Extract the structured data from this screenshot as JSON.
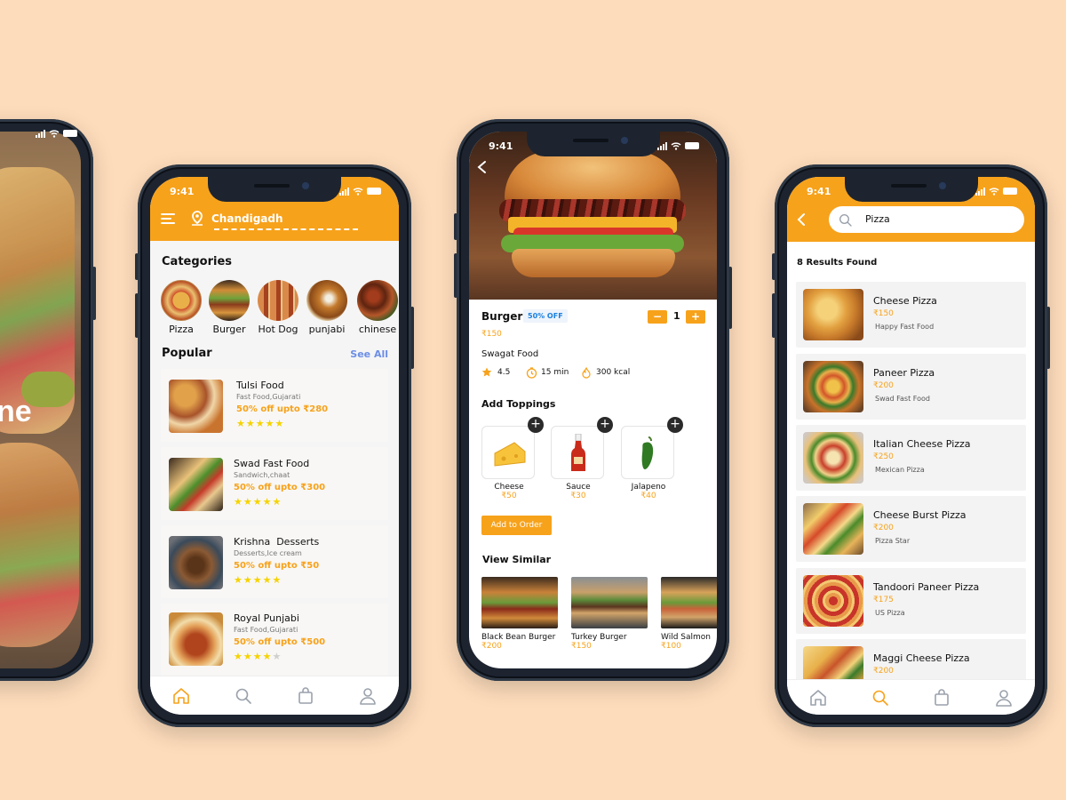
{
  "status_time": "9:41",
  "colors": {
    "accent": "#f7a21b",
    "background": "#fddcbb",
    "star": "#f5d300",
    "badge_text": "#1b7fe0"
  },
  "phone1": {
    "partial_text": "ne"
  },
  "phone2": {
    "location": "Chandigadh",
    "categories_title": "Categories",
    "categories": [
      {
        "label": "Pizza",
        "icon": "pizza-icon"
      },
      {
        "label": "Burger",
        "icon": "burger-icon"
      },
      {
        "label": "Hot Dog",
        "icon": "hotdog-icon"
      },
      {
        "label": "punjabi",
        "icon": "punjabi-dish-icon"
      },
      {
        "label": "chinese",
        "icon": "chinese-dish-icon"
      }
    ],
    "popular_title": "Popular",
    "see_all": "See All",
    "restaurants": [
      {
        "name": "Tulsi Food",
        "cuisine": "Fast Food,Gujarati",
        "offer": "50% off upto ₹280",
        "rating": 5
      },
      {
        "name": "Swad Fast Food",
        "cuisine": "Sandwich,chaat",
        "offer": "50% off upto ₹300",
        "rating": 5
      },
      {
        "name": "Krishna  Desserts",
        "cuisine": "Desserts,Ice cream",
        "offer": "50% off upto ₹50",
        "rating": 5
      },
      {
        "name": "Royal Punjabi",
        "cuisine": "Fast Food,Gujarati",
        "offer": "50% off upto ₹500",
        "rating": 4
      }
    ],
    "active_tab": "home"
  },
  "phone3": {
    "item_name": "Burger",
    "badge": "50% OFF",
    "price": "₹150",
    "quantity": "1",
    "qty_minus": "−",
    "qty_plus": "+",
    "restaurant": "Swagat Food",
    "rating": "4.5",
    "time": "15 min",
    "calories": "300 kcal",
    "toppings_title": "Add Toppings",
    "toppings": [
      {
        "name": "Cheese",
        "price": "₹50",
        "icon": "cheese-icon"
      },
      {
        "name": "Sauce",
        "price": "₹30",
        "icon": "sauce-bottle-icon"
      },
      {
        "name": "Jalapeno",
        "price": "₹40",
        "icon": "jalapeno-icon"
      }
    ],
    "add_button": "Add to Order",
    "similar_title": "View Similar",
    "similar": [
      {
        "name": "Black Bean Burger",
        "price": "₹200"
      },
      {
        "name": "Turkey Burger",
        "price": "₹150"
      },
      {
        "name": "Wild Salmon",
        "price": "₹100"
      }
    ]
  },
  "phone4": {
    "search_value": "Pizza",
    "results_text": "8 Results Found",
    "results": [
      {
        "name": "Cheese Pizza",
        "price": "₹150",
        "place": "Happy Fast Food"
      },
      {
        "name": "Paneer Pizza",
        "price": "₹200",
        "place": "Swad Fast Food"
      },
      {
        "name": "Italian Cheese Pizza",
        "price": "₹250",
        "place": "Mexican Pizza"
      },
      {
        "name": "Cheese Burst Pizza",
        "price": "₹200",
        "place": "Pizza Star"
      },
      {
        "name": "Tandoori Paneer Pizza",
        "price": "₹175",
        "place": "US Pizza"
      },
      {
        "name": "Maggi Cheese Pizza",
        "price": "₹200",
        "place": ""
      }
    ],
    "active_tab": "search"
  }
}
